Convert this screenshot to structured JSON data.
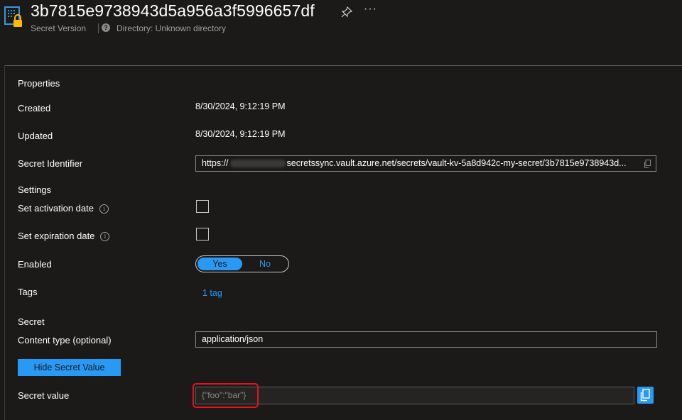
{
  "header": {
    "title": "3b7815e9738943d5a956a3f5996657df",
    "subtitle": "Secret Version",
    "directory": "Directory: Unknown directory",
    "more_label": "···"
  },
  "properties": {
    "section": "Properties",
    "created_label": "Created",
    "created_value": "8/30/2024, 9:12:19 PM",
    "updated_label": "Updated",
    "updated_value": "8/30/2024, 9:12:19 PM",
    "identifier_label": "Secret Identifier",
    "identifier_prefix": "https://",
    "identifier_suffix": "secretssync.vault.azure.net/secrets/vault-kv-5a8d942c-my-secret/3b7815e9738943d..."
  },
  "settings": {
    "section": "Settings",
    "activation_label": "Set activation date",
    "expiration_label": "Set expiration date",
    "enabled_label": "Enabled",
    "enabled_yes": "Yes",
    "enabled_no": "No",
    "enabled_value": "Yes",
    "tags_label": "Tags",
    "tags_link": "1 tag"
  },
  "secret": {
    "section": "Secret",
    "content_type_label": "Content type (optional)",
    "content_type_value": "application/json",
    "hide_button": "Hide Secret Value",
    "value_label": "Secret value",
    "value": "{\"foo\":\"bar\"}"
  },
  "colors": {
    "accent": "#2899f5",
    "background": "#1b1a19",
    "highlight": "#e81123"
  }
}
